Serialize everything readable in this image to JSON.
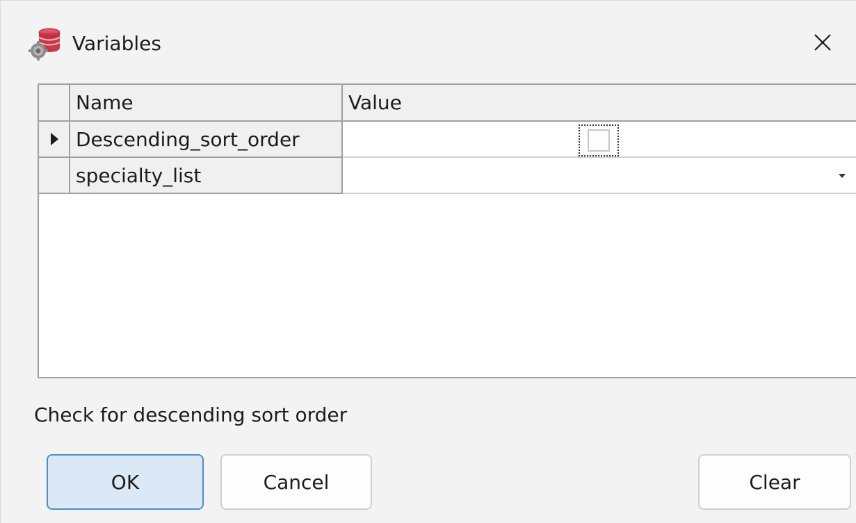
{
  "window": {
    "title": "Variables",
    "icon": "database-gear-icon"
  },
  "grid": {
    "columns": [
      "Name",
      "Value"
    ],
    "rows": [
      {
        "name": "Descending_sort_order",
        "value_type": "checkbox",
        "checked": false,
        "current": true
      },
      {
        "name": "specialty_list",
        "value_type": "dropdown",
        "value": "",
        "current": false
      }
    ]
  },
  "hint": "Check for descending sort order",
  "buttons": {
    "ok": "OK",
    "cancel": "Cancel",
    "clear": "Clear"
  },
  "colors": {
    "accent_border": "#4b8dc8",
    "accent_fill": "#dbe9f6",
    "icon_red": "#c8374a"
  }
}
